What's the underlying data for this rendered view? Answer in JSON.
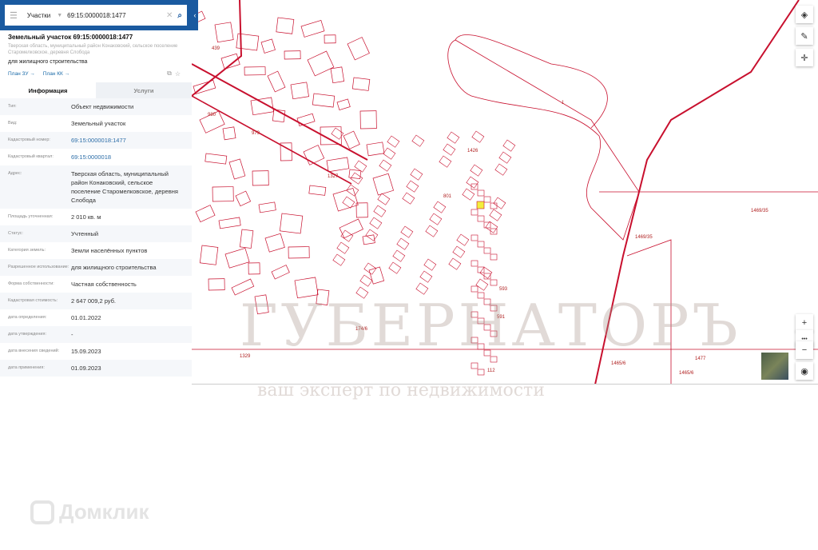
{
  "search": {
    "category": "Участки",
    "query": "69:15:0000018:1477"
  },
  "object": {
    "title": "Земельный участок 69:15:0000018:1477",
    "address": "Тверская область, муниципальный район Конаковский, сельское поселение Старомелковское, деревня Слобода",
    "use": "для жилищного строительства",
    "link_plan_zu": "План ЗУ →",
    "link_plan_kk": "План КК →"
  },
  "tabs": {
    "info": "Информация",
    "services": "Услуги"
  },
  "rows": [
    {
      "label": "Тип:",
      "value": "Объект недвижимости"
    },
    {
      "label": "Вид:",
      "value": "Земельный участок"
    },
    {
      "label": "Кадастровый номер:",
      "value": "69:15:0000018:1477"
    },
    {
      "label": "Кадастровый квартал:",
      "value": "69:15:0000018"
    },
    {
      "label": "Адрес:",
      "value": "Тверская область, муниципальный район Конаковский, сельское поселение Старомелковское, деревня Слобода"
    },
    {
      "label": "Площадь уточненная:",
      "value": "2 010 кв. м"
    },
    {
      "label": "Статус:",
      "value": "Учтенный"
    },
    {
      "label": "Категория земель:",
      "value": "Земли населённых пунктов"
    },
    {
      "label": "Разрешенное использование:",
      "value": "для жилищного строительства"
    },
    {
      "label": "Форма собственности:",
      "value": "Частная собственность"
    },
    {
      "label": "Кадастровая стоимость:",
      "value": "2 647 009,2 руб."
    },
    {
      "label": "дата определения:",
      "value": "01.01.2022"
    },
    {
      "label": "дата утверждения:",
      "value": "-"
    },
    {
      "label": "дата внесения сведений:",
      "value": "15.09.2023"
    },
    {
      "label": "дата применения:",
      "value": "01.09.2023"
    }
  ],
  "map": {
    "labels": [
      "1",
      "1426",
      "1469/35",
      "1469/35",
      "1327",
      "801",
      "593",
      "591",
      "1465/6",
      "1465/6",
      "1477",
      "174/6",
      "1329",
      "112",
      "439",
      "980",
      "979"
    ],
    "accent": "#c8102e",
    "highlight": "#f2ee3c"
  },
  "controls": {
    "zoom_in": "+",
    "more": "•••",
    "zoom_out": "−"
  },
  "watermark": {
    "brand": "ГУБЕРНАТОРЪ",
    "slogan": "ваш эксперт по недвижимости",
    "logo": "Домклик"
  }
}
